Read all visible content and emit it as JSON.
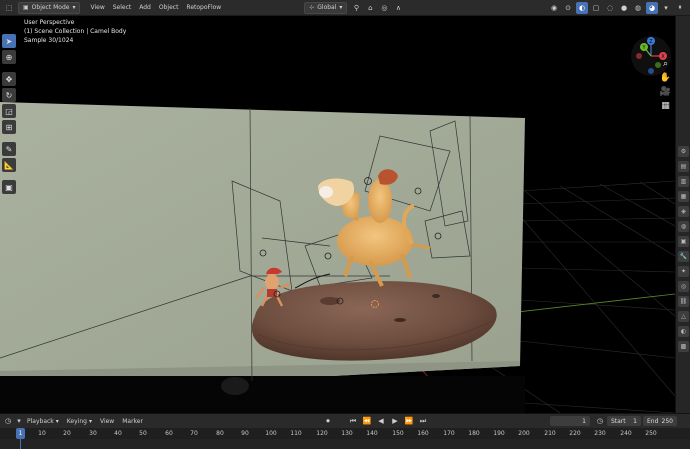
{
  "header": {
    "mode": "Object Mode",
    "menu": [
      "View",
      "Select",
      "Add",
      "Object",
      "RetopoFlow"
    ],
    "transform_orientation": "Global"
  },
  "viewport": {
    "perspective": "User Perspective",
    "collection": "(1) Scene Collection | Camel Body",
    "sample": "Sample 30/1024"
  },
  "gizmo": {
    "x": "X",
    "y": "Y",
    "z": "Z"
  },
  "timeline": {
    "menu": [
      "Playback",
      "Keying",
      "View",
      "Marker"
    ],
    "current_frame": "1",
    "start_label": "Start",
    "start": "1",
    "end_label": "End",
    "end": "250",
    "ticks": [
      "10",
      "20",
      "30",
      "40",
      "50",
      "60",
      "70",
      "80",
      "90",
      "100",
      "110",
      "120",
      "130",
      "140",
      "150",
      "160",
      "170",
      "180",
      "190",
      "200",
      "210",
      "220",
      "230",
      "240",
      "250"
    ],
    "playhead": "1"
  },
  "icons": {
    "select": "cursor-arrow-icon",
    "cursor": "3d-cursor-icon",
    "move": "move-icon",
    "rotate": "rotate-icon",
    "scale": "scale-icon",
    "transform": "transform-icon",
    "annotate": "annotate-icon",
    "measure": "measure-icon",
    "add_cube": "add-cube-icon"
  },
  "colors": {
    "accent": "#4772b3",
    "axis_x": "#e0414a",
    "axis_y": "#6bb92b",
    "axis_z": "#3d7bd9",
    "backdrop": "#a7ad9c",
    "rock": "#6e4e3f"
  }
}
